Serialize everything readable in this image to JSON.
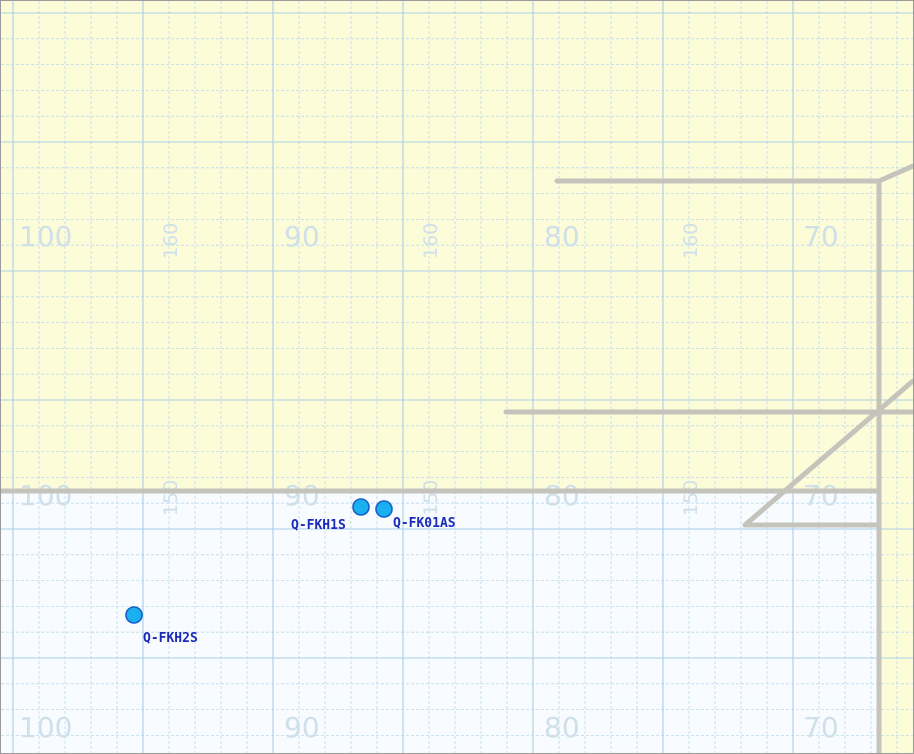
{
  "map": {
    "colors": {
      "land": "#fdfcd8",
      "water": "#f8fbff",
      "grid_major": "#a9cfe8",
      "grid_minor": "#bcd9ee",
      "coastline": "#c4c4bc",
      "station_fill": "#1ab0f0",
      "station_stroke": "#1560c8",
      "station_label": "#1a2bb8",
      "grid_label": "#cfe0ea"
    },
    "grid_labels": [
      {
        "id": "row1-100",
        "text": "100"
      },
      {
        "id": "row1-90",
        "text": "90"
      },
      {
        "id": "row1-80",
        "text": "80"
      },
      {
        "id": "row1-70",
        "text": "70"
      },
      {
        "id": "row2-100",
        "text": "100"
      },
      {
        "id": "row2-90",
        "text": "90"
      },
      {
        "id": "row2-80",
        "text": "80"
      },
      {
        "id": "row2-70",
        "text": "70"
      },
      {
        "id": "row3-100",
        "text": "100"
      },
      {
        "id": "row3-90",
        "text": "90"
      },
      {
        "id": "row3-80",
        "text": "80"
      },
      {
        "id": "row3-70",
        "text": "70"
      }
    ],
    "grid_labels_rotated": [
      {
        "id": "rot1-a",
        "text": "160"
      },
      {
        "id": "rot1-b",
        "text": "160"
      },
      {
        "id": "rot1-c",
        "text": "160"
      },
      {
        "id": "rot2-a",
        "text": "150"
      },
      {
        "id": "rot2-b",
        "text": "150"
      },
      {
        "id": "rot2-c",
        "text": "150"
      }
    ],
    "stations": [
      {
        "name": "Q-FKH1S"
      },
      {
        "name": "Q-FK01AS"
      },
      {
        "name": "Q-FKH2S"
      }
    ]
  }
}
